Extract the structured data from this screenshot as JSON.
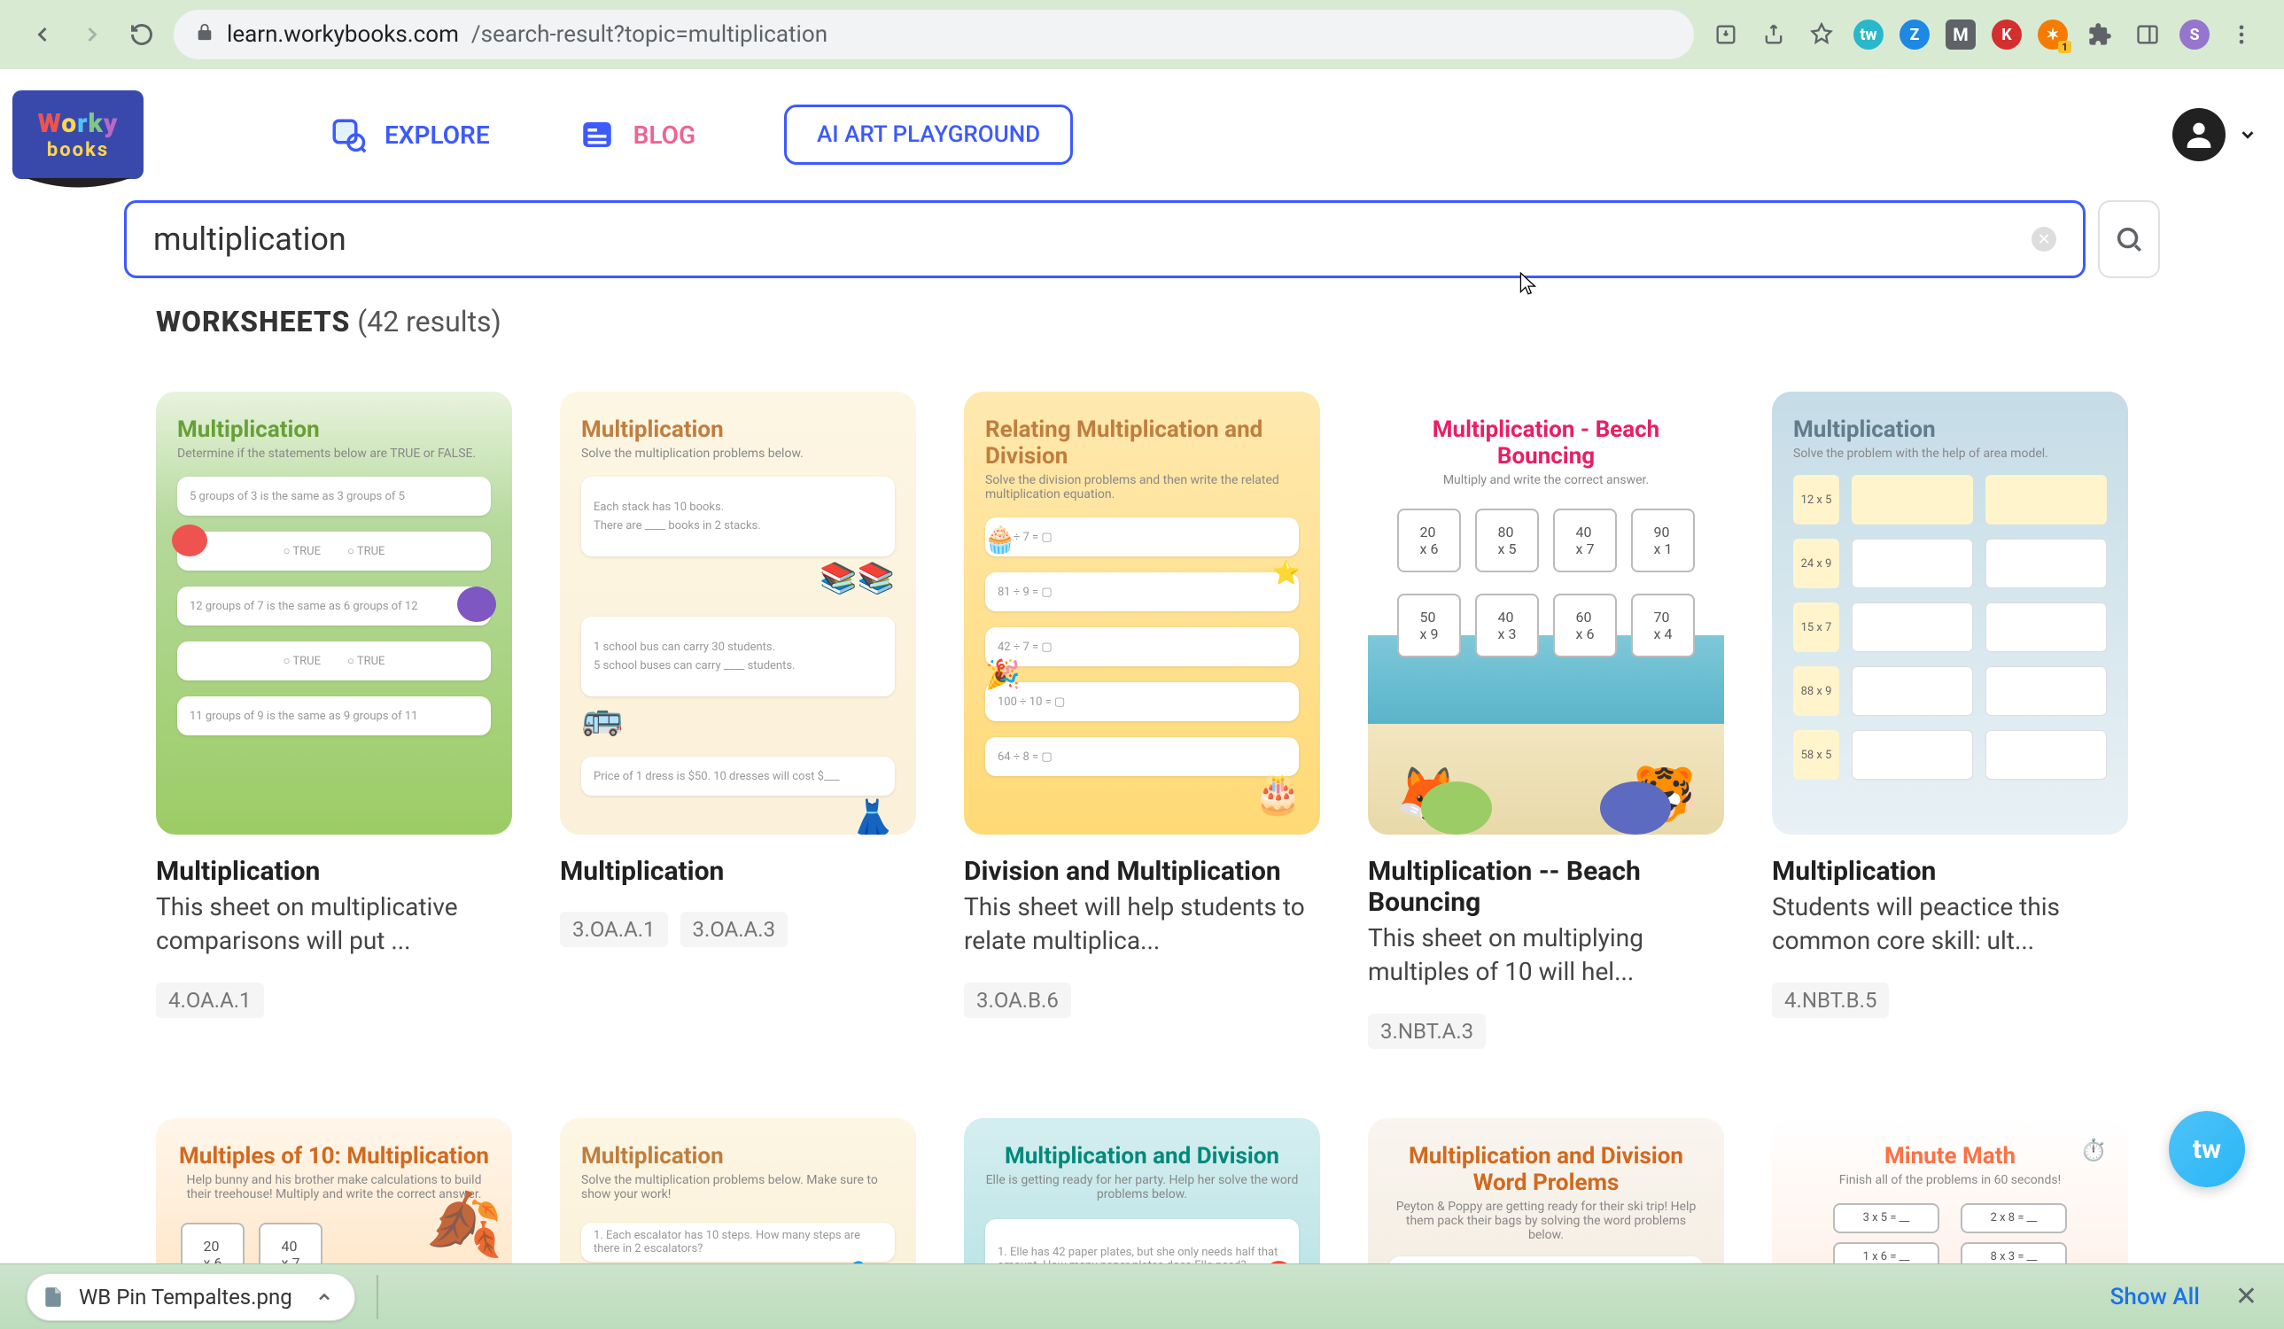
{
  "browser": {
    "url_host": "learn.workybooks.com",
    "url_path": "/search-result?topic=multiplication"
  },
  "nav": {
    "explore": "EXPLORE",
    "blog": "BLOG",
    "ai_playground": "AI ART PLAYGROUND"
  },
  "logo": {
    "line1": "Worky",
    "line2": "books"
  },
  "search": {
    "value": "multiplication"
  },
  "results": {
    "label": "WORKSHEETS",
    "count_text": "(42 results)"
  },
  "cards": [
    {
      "thumb_title": "Multiplication",
      "thumb_sub": "Determine if the statements below are TRUE or FALSE.",
      "title": "Multiplication",
      "desc": "This sheet on multiplicative comparisons will put ...",
      "tags": [
        "4.OA.A.1"
      ],
      "theme": "th-green"
    },
    {
      "thumb_title": "Multiplication",
      "thumb_sub": "Solve the multiplication problems below.",
      "title": "Multiplication",
      "desc": "",
      "tags": [
        "3.OA.A.1",
        "3.OA.A.3"
      ],
      "theme": "th-cream"
    },
    {
      "thumb_title": "Relating Multiplication and Division",
      "thumb_sub": "Solve the division problems and then write the related multiplication equation.",
      "title": "Division and Multiplication",
      "desc": "This sheet will help students to relate multiplica...",
      "tags": [
        "3.OA.B.6"
      ],
      "theme": "th-yellow"
    },
    {
      "thumb_title": "Multiplication - Beach Bouncing",
      "thumb_sub": "Multiply and write the correct answer.",
      "title": "Multiplication -- Beach Bouncing",
      "desc": "This sheet on multiplying multiples of 10 will hel...",
      "tags": [
        "3.NBT.A.3"
      ],
      "theme": "th-beach"
    },
    {
      "thumb_title": "Multiplication",
      "thumb_sub": "Solve the problem with the help of area model.",
      "title": "Multiplication",
      "desc": "Students will peactice this common core skill: ult...",
      "tags": [
        "4.NBT.B.5"
      ],
      "theme": "th-blue"
    }
  ],
  "cards_row2": [
    {
      "thumb_title": "Multiples of 10: Multiplication",
      "thumb_sub": "Help bunny and his brother make calculations to build their treehouse! Multiply and write the correct answer.",
      "theme": "th-orange"
    },
    {
      "thumb_title": "Multiplication",
      "thumb_sub": "Solve the multiplication problems below. Make sure to show your work!",
      "theme": "th-cream2"
    },
    {
      "thumb_title": "Multiplication and Division",
      "thumb_sub": "Elle is getting ready for her party. Help her solve the word problems below.",
      "theme": "th-teal"
    },
    {
      "thumb_title": "Multiplication and Division Word Prolems",
      "thumb_sub": "Peyton & Poppy are getting ready for their ski trip! Help them pack their bags by solving the word problems below.",
      "theme": "th-pale"
    },
    {
      "thumb_title": "Minute Math",
      "thumb_sub": "Finish all of the problems in 60 seconds!",
      "theme": "th-minute"
    }
  ],
  "downloads": {
    "file": "WB Pin Tempaltes.png",
    "show_all": "Show All"
  }
}
